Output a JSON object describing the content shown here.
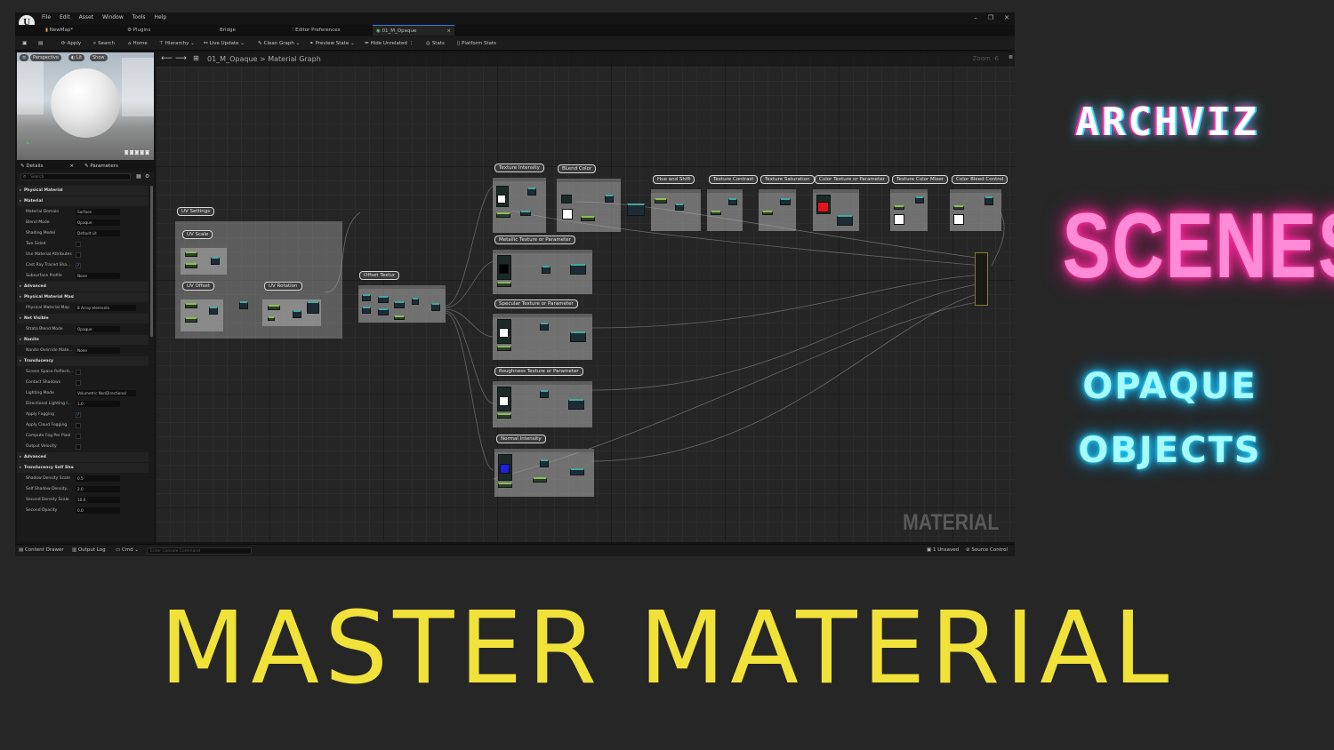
{
  "editor": {
    "logo": "U",
    "menu": [
      "File",
      "Edit",
      "Asset",
      "Window",
      "Tools",
      "Help"
    ],
    "window_controls": [
      "–",
      "❐",
      "✕"
    ],
    "tabs": [
      "NewMap*",
      "Plugins",
      "Bridge",
      "Editor Preferences",
      "01_M_Opaque"
    ],
    "toolbar": [
      "Apply",
      "Search",
      "Home",
      "Hierarchy",
      "Live Update",
      "Clean Graph",
      "Preview State",
      "Hide Unrelated",
      "Stats",
      "Platform Stats"
    ],
    "viewport": {
      "buttons": [
        "Perspective",
        "Lit",
        "Show"
      ]
    },
    "details": {
      "tabs": [
        "Details",
        "Parameters"
      ],
      "search_placeholder": "Search",
      "rows": [
        {
          "label": "Physical Material",
          "section": true
        },
        {
          "label": "Material",
          "section": true
        },
        {
          "label": "Material Domain",
          "value": "Surface"
        },
        {
          "label": "Blend Mode",
          "value": "Opaque"
        },
        {
          "label": "Shading Model",
          "value": "Default Lit"
        },
        {
          "label": "Two Sided",
          "check": ""
        },
        {
          "label": "Use Material Attributes",
          "check": ""
        },
        {
          "label": "Cast Ray Traced Sha...",
          "check": "✓"
        },
        {
          "label": "Subsurface Profile",
          "value": "None"
        },
        {
          "label": "Advanced",
          "section": true
        },
        {
          "label": "Physical Material Mask",
          "section": true
        },
        {
          "label": "Physical Material Map",
          "value": "8 Array elements"
        },
        {
          "label": "Net Visible",
          "section": true
        },
        {
          "label": "Strata Blend Mode",
          "value": "Opaque"
        },
        {
          "label": "Nanite",
          "section": true
        },
        {
          "label": "Nanite Override Mate...",
          "value": "None"
        },
        {
          "label": "Translucency",
          "section": true
        },
        {
          "label": "Screen Space Reflecti...",
          "check": ""
        },
        {
          "label": "Contact Shadows",
          "check": ""
        },
        {
          "label": "Lighting Mode",
          "value": "Volumetric NonDirectional"
        },
        {
          "label": "Directional Lighting I...",
          "value": "1.0"
        },
        {
          "label": "Apply Fogging",
          "check": "✓"
        },
        {
          "label": "Apply Cloud Fogging",
          "check": ""
        },
        {
          "label": "Compute Fog Per Pixel",
          "check": ""
        },
        {
          "label": "Output Velocity",
          "check": ""
        },
        {
          "label": "Advanced",
          "section": true
        },
        {
          "label": "Translucency Self Shadowing",
          "section": true
        },
        {
          "label": "Shadow Density Scale",
          "value": "0.5"
        },
        {
          "label": "Self Shadow Density...",
          "value": "2.0"
        },
        {
          "label": "Second Density Scale",
          "value": "10.0"
        },
        {
          "label": "Second Opacity",
          "value": "0.0"
        }
      ]
    },
    "graph": {
      "breadcrumb": "01_M_Opaque > Material Graph",
      "zoom": "Zoom -6",
      "watermark": "MATERIAL",
      "nodes": [
        "UV Settings",
        "UV Scale",
        "UV Offset",
        "UV Rotation",
        "Offset Textur",
        "Texture Intensity",
        "BLend Color",
        "Metallic Texture or Parameter",
        "Specular Texture or Parameter",
        "Roughness Texture or Parameter",
        "Normal Intensity",
        "Hue and Shift",
        "Texture Contrast",
        "Texture Saturation",
        "Color Texture or Parameter",
        "Texture Color Mixer",
        "Color Bleed Control"
      ]
    },
    "status": {
      "content_drawer": "Content Drawer",
      "output_log": "Output Log",
      "cmd": "Cmd",
      "console_placeholder": "Enter Console Command",
      "unsaved": "1 Unsaved",
      "source_control": "Source Control"
    }
  },
  "titles": {
    "archviz": "ARCHVIZ",
    "scenes": "SCENES",
    "opaque": "OPAQUE",
    "objects": "OBJECTS",
    "main": "MASTER MATERIAL"
  },
  "colors": {
    "background": "#262626",
    "neon_pink": "#ff2d9e",
    "neon_cyan": "#23e0ff",
    "title_yellow": "#f1e23a"
  }
}
